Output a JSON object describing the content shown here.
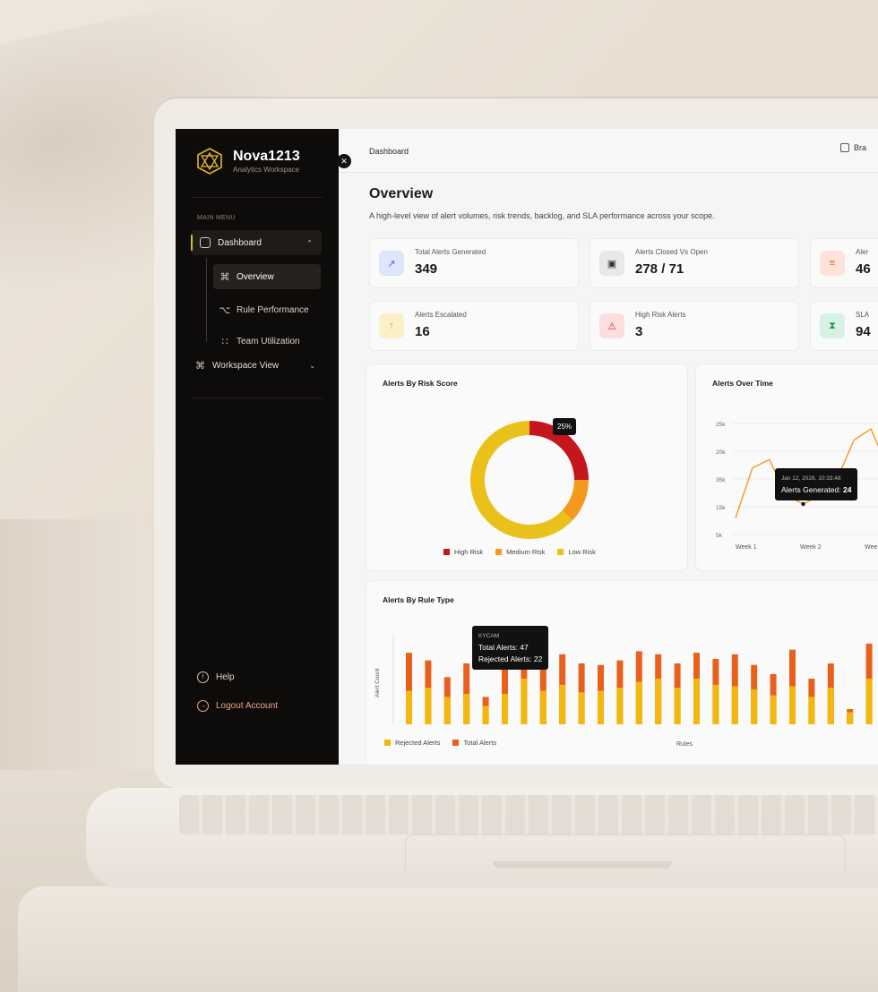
{
  "brand": {
    "name": "Nova1213",
    "sub": "Analytics Workspace"
  },
  "sidebar": {
    "menu_label": "MAIN MENU",
    "dashboard": "Dashboard",
    "subitems": [
      {
        "label": "Overview",
        "icon": "grid-icon"
      },
      {
        "label": "Rule Performance",
        "icon": "rules-icon"
      },
      {
        "label": "Team Utilization",
        "icon": "team-icon"
      }
    ],
    "workspace": "Workspace View",
    "help": "Help",
    "logout": "Logout Account"
  },
  "topbar": {
    "breadcrumb": "Dashboard",
    "button": "Bra"
  },
  "page": {
    "title": "Overview",
    "description": "A high-level view of alert volumes, risk trends, backlog, and SLA performance across your scope."
  },
  "cards": [
    {
      "label": "Total Alerts Generated",
      "value": "349",
      "icon": "trend-icon",
      "color": "#dde6fb"
    },
    {
      "label": "Alerts Closed Vs Open",
      "value": "278 / 71",
      "icon": "clipboard-icon",
      "color": "#e8e8ea"
    },
    {
      "label": "Aler",
      "value": "46",
      "icon": "layers-icon",
      "color": "#fde3da"
    },
    {
      "label": "Alerts Escalated",
      "value": "16",
      "icon": "escalate-icon",
      "color": "#fbf0c8"
    },
    {
      "label": "High Risk Alerts",
      "value": "3",
      "icon": "warning-icon",
      "color": "#fbdede"
    },
    {
      "label": "SLA",
      "value": "94",
      "icon": "hourglass-icon",
      "color": "#d8f1e3"
    }
  ],
  "risk_chart": {
    "title": "Alerts By Risk Score",
    "badge": "25%",
    "legend": [
      "High Risk",
      "Medium Risk",
      "Low Risk"
    ],
    "colors": {
      "high": "#c4161c",
      "medium": "#f39a1e",
      "low": "#e9c11a"
    }
  },
  "time_chart": {
    "title": "Alerts Over Time",
    "tooltip_date": "Jan 12, 2026, 10:33:48",
    "tooltip_label": "Alerts Generated:",
    "tooltip_value": "24"
  },
  "rule_chart": {
    "title": "Alerts By Rule Type",
    "ylabel": "Alert Count",
    "xlabel": "Rules",
    "tooltip_rule": "KYCAM",
    "tooltip_total": "Total Alerts: 47",
    "tooltip_rejected": "Rejected Alerts: 22",
    "legend": [
      "Rejected Alerts",
      "Total Alerts"
    ],
    "colors": {
      "rejected": "#f2b80f",
      "total": "#e8601c"
    }
  },
  "chart_data": [
    {
      "type": "pie",
      "title": "Alerts By Risk Score",
      "categories": [
        "High Risk",
        "Medium Risk",
        "Low Risk"
      ],
      "values": [
        25,
        12,
        63
      ],
      "legend": "bottom"
    },
    {
      "type": "line",
      "title": "Alerts Over Time",
      "x": [
        "Week 1",
        "Week 2",
        "Wee"
      ],
      "yticks": [
        "25k",
        "20k",
        "35k",
        "15k",
        "5k"
      ],
      "series": [
        {
          "values": [
            8,
            17,
            18.5,
            12,
            10.5,
            12,
            15,
            22,
            24,
            17
          ]
        }
      ],
      "ylim": [
        5,
        25
      ]
    },
    {
      "type": "bar",
      "title": "Alerts By Rule Type",
      "xlabel": "Rules",
      "ylabel": "Alert Count",
      "series": [
        {
          "name": "Total Alerts",
          "values": [
            47,
            42,
            31,
            40,
            18,
            45,
            46,
            47,
            46,
            40,
            39,
            42,
            48,
            46,
            40,
            47,
            43,
            46,
            39,
            33,
            49,
            30,
            40,
            10,
            53,
            47
          ]
        },
        {
          "name": "Rejected Alerts",
          "values": [
            22,
            24,
            18,
            20,
            12,
            20,
            30,
            22,
            26,
            21,
            22,
            24,
            28,
            30,
            24,
            30,
            26,
            25,
            23,
            19,
            25,
            18,
            24,
            8,
            30,
            26
          ]
        }
      ],
      "legend": "bottom-left"
    }
  ]
}
